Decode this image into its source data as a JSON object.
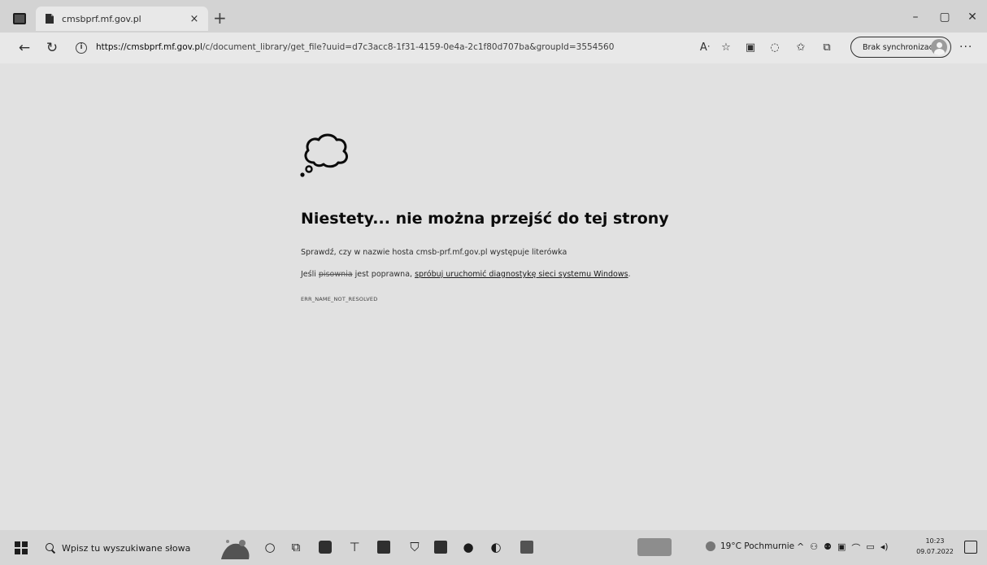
{
  "browser": {
    "tab_title": "cmsbprf.mf.gov.pl",
    "tab_close": "×",
    "new_tab": "+",
    "url_host": "https://cmsbprf.mf.gov.pl",
    "url_path": "/c/document_library/get_file?uuid=d7c3acc8-1f31-4159-0e4a-2c1f80d707ba&groupId=3554560",
    "sync_label": "Brak synchronizacji",
    "window_controls": {
      "minimize": "–",
      "maximize": "▢",
      "close": "✕"
    },
    "toolbar_icons": [
      "read-aloud-icon",
      "favorite-add-icon",
      "extensions-icon",
      "browser-essentials-icon",
      "favorites-icon",
      "collections-icon"
    ]
  },
  "error": {
    "title": "Niestety... nie można przejść do tej strony",
    "hint1": "Sprawdź, czy w nazwie hosta cmsb-prf.mf.gov.pl występuje literówka",
    "hint2_prefix": "Jeśli",
    "hint2_struck": "pisownia",
    "hint2_mid": "jest poprawna,",
    "hint2_link": "spróbuj uruchomić diagnostykę sieci systemu Windows",
    "hint2_suffix": ".",
    "code": "ERR_NAME_NOT_RESOLVED"
  },
  "taskbar": {
    "search_placeholder": "Wpisz tu wyszukiwane słowa",
    "weather": "19°C Pochmurnie",
    "clock_time": "10:23",
    "clock_date": "09.07.2022"
  }
}
